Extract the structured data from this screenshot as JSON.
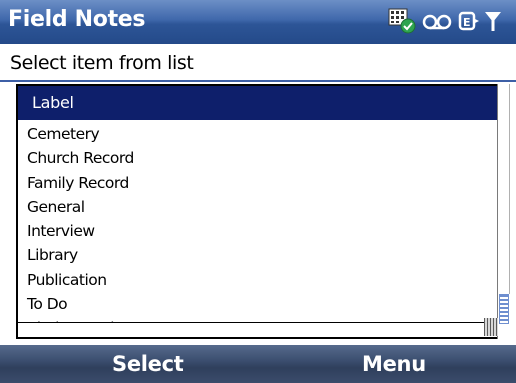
{
  "app": {
    "title": "Field Notes"
  },
  "status_icons": [
    "calendar-sync-icon",
    "voicemail-icon",
    "data-connection-icon",
    "signal-strength-icon"
  ],
  "prompt": "Select item from list",
  "list": {
    "header": "Label",
    "items": [
      "Cemetery",
      "Church Record",
      "Family Record",
      "General",
      "Interview",
      "Library",
      "Publication",
      "To Do",
      "Vital Record"
    ]
  },
  "softkeys": {
    "left": "Select",
    "right": "Menu"
  },
  "colors": {
    "title_bar": "#3f68ab",
    "list_header": "#0e1f6b",
    "soft_bar": "#3c4f70"
  }
}
